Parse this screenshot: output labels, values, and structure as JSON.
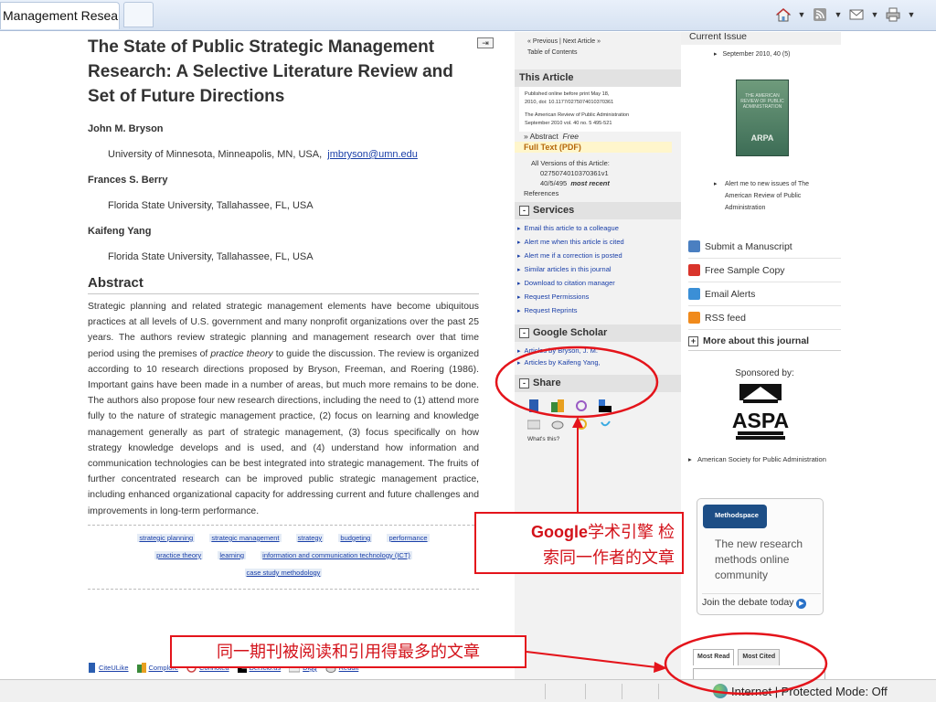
{
  "browser": {
    "tab_title": "Management Resear...",
    "status_zone": "Internet | Protected Mode: Off"
  },
  "article": {
    "expand_glyph": "⇥",
    "title": "The State of Public Strategic Management Research: A Selective Literature Review and Set of Future Directions",
    "authors": [
      {
        "name": "John M. Bryson",
        "affiliation": "University of Minnesota, Minneapolis, MN, USA,",
        "email": "jmbryson@umn.edu"
      },
      {
        "name": "Frances S. Berry",
        "affiliation": "Florida State University, Tallahassee, FL, USA"
      },
      {
        "name": "Kaifeng Yang",
        "affiliation": "Florida State University, Tallahassee, FL, USA"
      }
    ],
    "abstract_heading": "Abstract",
    "abstract_parts": {
      "a": "Strategic planning and related strategic management elements have become ubiquitous practices at all levels of U.S. government and many nonprofit organizations over the past 25 years. The authors review strategic planning and management research over that time period using the premises of ",
      "em": "practice theory",
      "b": " to guide the discussion. The review is organized according to 10 research directions proposed by Bryson, Freeman, and Roering (1986). Important gains have been made in a number of areas, but much more remains to be done. The authors also propose four new research directions, including the need to (1) attend more fully to the nature of strategic management practice, (2) focus on learning and knowledge management generally as part of strategic management, (3) focus specifically on how strategy knowledge develops and is used, and (4) understand how information and communication technologies can be best integrated into strategic management. The fruits of further concentrated research can be improved public strategic management practice, including enhanced organizational capacity for addressing current and future challenges and improvements in long-term performance."
    },
    "keywords": [
      "strategic planning",
      "strategic management",
      "strategy",
      "budgeting",
      "performance",
      "practice theory",
      "learning",
      "information and communication technology (ICT)",
      "case study methodology"
    ],
    "social": [
      "CiteULike",
      "Complore",
      "Connotea",
      "Del.icio.us",
      "Digg",
      "Reddit"
    ]
  },
  "middle": {
    "prev_next": "« Previous | Next Article »",
    "toc": "Table of Contents",
    "this_article_h": "This Article",
    "published_line1": "Published online before print May 18,",
    "published_line2": "2010, doi: 10.1177/0275074010370361",
    "journal_line1": "The American Review of Public Administration",
    "journal_line2": "September 2010 vol. 40 no. 5 495-521",
    "abstract_link": "» Abstract",
    "abstract_free": "Free",
    "fulltext_link": "Full Text (PDF)",
    "versions_line1": "All Versions of this Article:",
    "versions_line2": "0275074010370361v1",
    "versions_line3": "40/5/495",
    "versions_mr": "most recent",
    "references": "References",
    "services_h": "Services",
    "services": [
      "Email this article to a colleague",
      "Alert me when this article is cited",
      "Alert me if a correction is posted",
      "Similar articles in this journal",
      "Download to citation manager",
      "Request Permissions",
      "Request Reprints"
    ],
    "scholar_h": "Google Scholar",
    "scholar_links": [
      "Articles by Bryson, J. M.",
      "Articles by Kaifeng Yang,"
    ],
    "share_h": "Share",
    "whats_this": "What's this?"
  },
  "right": {
    "current_issue_h": "Current Issue",
    "issue_date": "September 2010, 40 (5)",
    "cover_title": "THE AMERICAN REVIEW OF PUBLIC ADMINISTRATION",
    "cover_logo": "ARPA",
    "alert_issues": "Alert me to new issues of The American Review of Public Administration",
    "links": [
      {
        "label": "Submit a Manuscript",
        "color": "#4a7fc1"
      },
      {
        "label": "Free Sample Copy",
        "color": "#d9342b"
      },
      {
        "label": "Email Alerts",
        "color": "#3b8fd6"
      },
      {
        "label": "RSS feed",
        "color": "#f08a1c"
      }
    ],
    "more_journal": "More about this journal",
    "sponsored_by": "Sponsored by:",
    "aspa_logo_text": "ASPA",
    "aspa_name": "American Society for Public Administration",
    "methodspace_badge": "Methodspace",
    "methodspace_text": "The new research methods online community",
    "methodspace_join": "Join the debate today",
    "tab_most_read": "Most Read",
    "tab_most_cited": "Most Cited"
  },
  "annotations": {
    "scholar_note_brand": "Google",
    "scholar_note_rest": "学术引擎 检",
    "scholar_note_line2": "索同一作者的文章",
    "most_read_note": "同一期刊被阅读和引用得最多的文章",
    "accent_color": "#e4141b"
  }
}
